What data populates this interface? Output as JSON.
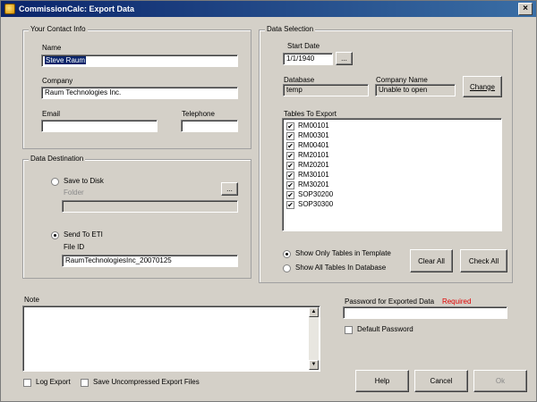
{
  "window": {
    "title": "CommissionCalc: Export Data",
    "close_glyph": "×"
  },
  "contact": {
    "group_title": "Your Contact Info",
    "name_label": "Name",
    "name_value": "Steve Raum",
    "company_label": "Company",
    "company_value": "Raum Technologies Inc.",
    "email_label": "Email",
    "email_value": "",
    "telephone_label": "Telephone",
    "telephone_value": ""
  },
  "destination": {
    "group_title": "Data Destination",
    "save_to_disk_label": "Save to Disk",
    "folder_label": "Folder",
    "folder_value": "",
    "browse_label": "...",
    "send_to_eti_label": "Send To ETI",
    "file_id_label": "File ID",
    "file_id_value": "RaumTechnologiesInc_20070125"
  },
  "selection": {
    "group_title": "Data Selection",
    "start_date_label": "Start Date",
    "start_date_value": "1/1/1940",
    "date_picker_label": "...",
    "database_label": "Database",
    "database_value": "temp",
    "company_name_label": "Company Name",
    "company_name_value": "Unable to open",
    "change_label": "Change",
    "tables_label": "Tables To Export",
    "tables": [
      {
        "name": "RM00101",
        "checked": true
      },
      {
        "name": "RM00301",
        "checked": true
      },
      {
        "name": "RM00401",
        "checked": true
      },
      {
        "name": "RM20101",
        "checked": true
      },
      {
        "name": "RM20201",
        "checked": true
      },
      {
        "name": "RM30101",
        "checked": true
      },
      {
        "name": "RM30201",
        "checked": true
      },
      {
        "name": "SOP30200",
        "checked": true
      },
      {
        "name": "SOP30300",
        "checked": true
      }
    ],
    "check_glyph": "✔",
    "show_only_label": "Show Only Tables in Template",
    "show_all_label": "Show All Tables In Database",
    "clear_all_label": "Clear All",
    "check_all_label": "Check All"
  },
  "note": {
    "label": "Note",
    "value": ""
  },
  "password": {
    "label": "Password for Exported Data",
    "required_label": "Required",
    "value": "",
    "default_password_label": "Default Password"
  },
  "options": {
    "log_export_label": "Log Export",
    "save_uncompressed_label": "Save Uncompressed Export Files"
  },
  "footer": {
    "help_label": "Help",
    "cancel_label": "Cancel",
    "ok_label": "Ok"
  }
}
